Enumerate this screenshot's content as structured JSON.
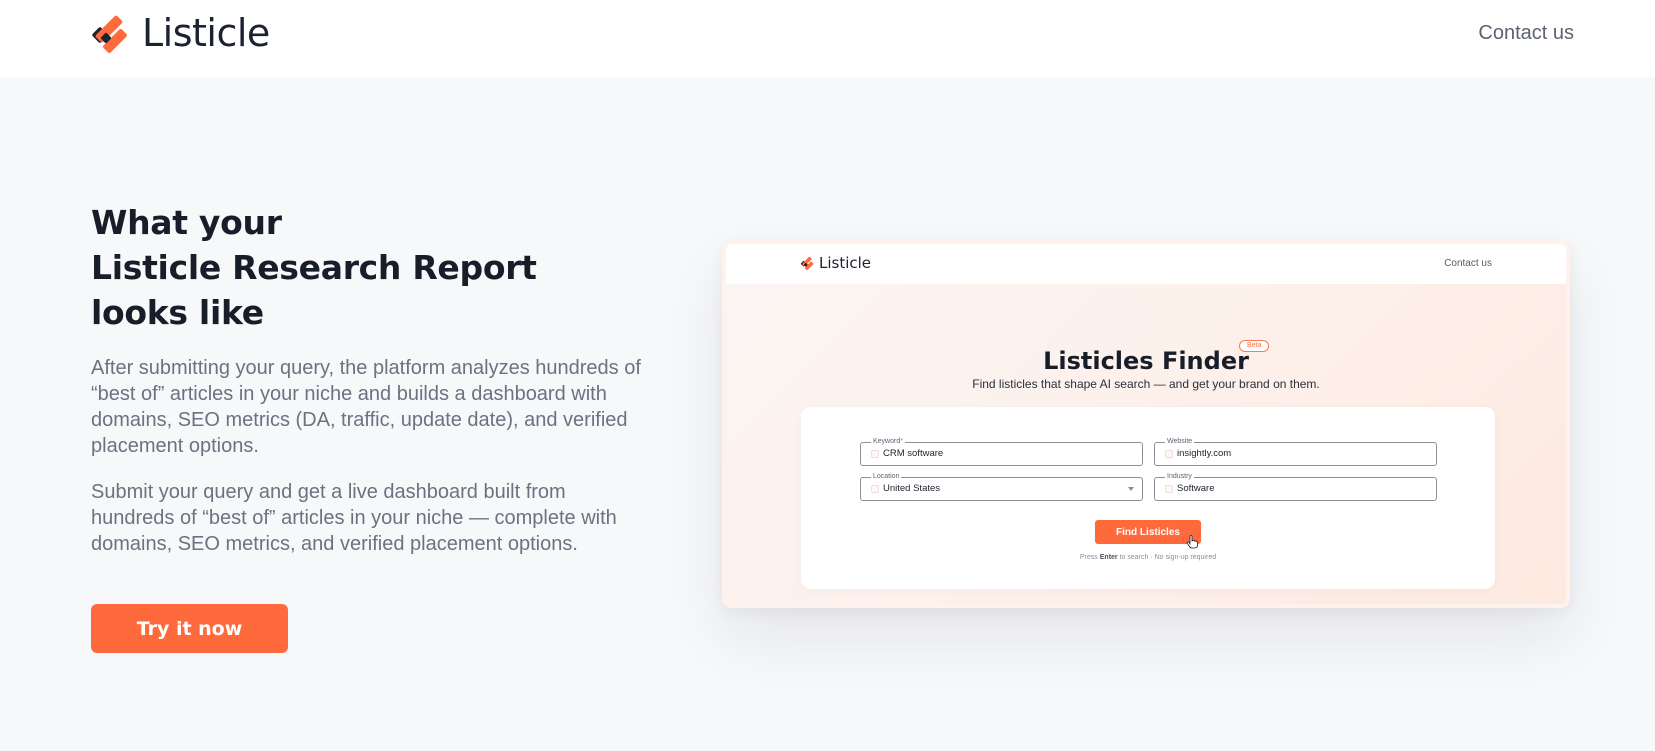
{
  "header": {
    "brand": "Listicle",
    "contact": "Contact us"
  },
  "hero": {
    "title_lines": [
      "What your",
      "Listicle Research Report",
      "looks like"
    ],
    "paragraph1": "After submitting your query, the platform analyzes hundreds of “best of” articles in your niche and builds a dashboard with domains, SEO metrics (DA, traffic, update date), and verified placement options.",
    "paragraph2": "Submit your query and get a live dashboard built from hundreds of “best of” articles in your niche — complete with domains, SEO metrics, and verified placement options.",
    "cta": "Try it now"
  },
  "preview": {
    "brand": "Listicle",
    "contact": "Contact us",
    "title": "Listicles Finder",
    "badge": "Beta",
    "subtitle": "Find listicles that shape AI search — and get your brand on them.",
    "fields": {
      "keyword": {
        "label": "Keyword",
        "required_mark": "*",
        "value": "CRM software"
      },
      "website": {
        "label": "Website",
        "value": "insightly.com"
      },
      "location": {
        "label": "Location",
        "value": "United States"
      },
      "industry": {
        "label": "Industry",
        "value": "Software"
      }
    },
    "button": "Find Listicles",
    "hint_prefix": "Press",
    "hint_key": "Enter",
    "hint_suffix": "to search · No sign-up required"
  },
  "colors": {
    "accent": "#ff6a3d",
    "text_dark": "#181e29",
    "text_muted": "#6b7280",
    "background": "#f7f8fa"
  },
  "icons": [
    "listicle-logo-icon",
    "field-icon",
    "chevron-down-icon",
    "hand-cursor-icon"
  ]
}
